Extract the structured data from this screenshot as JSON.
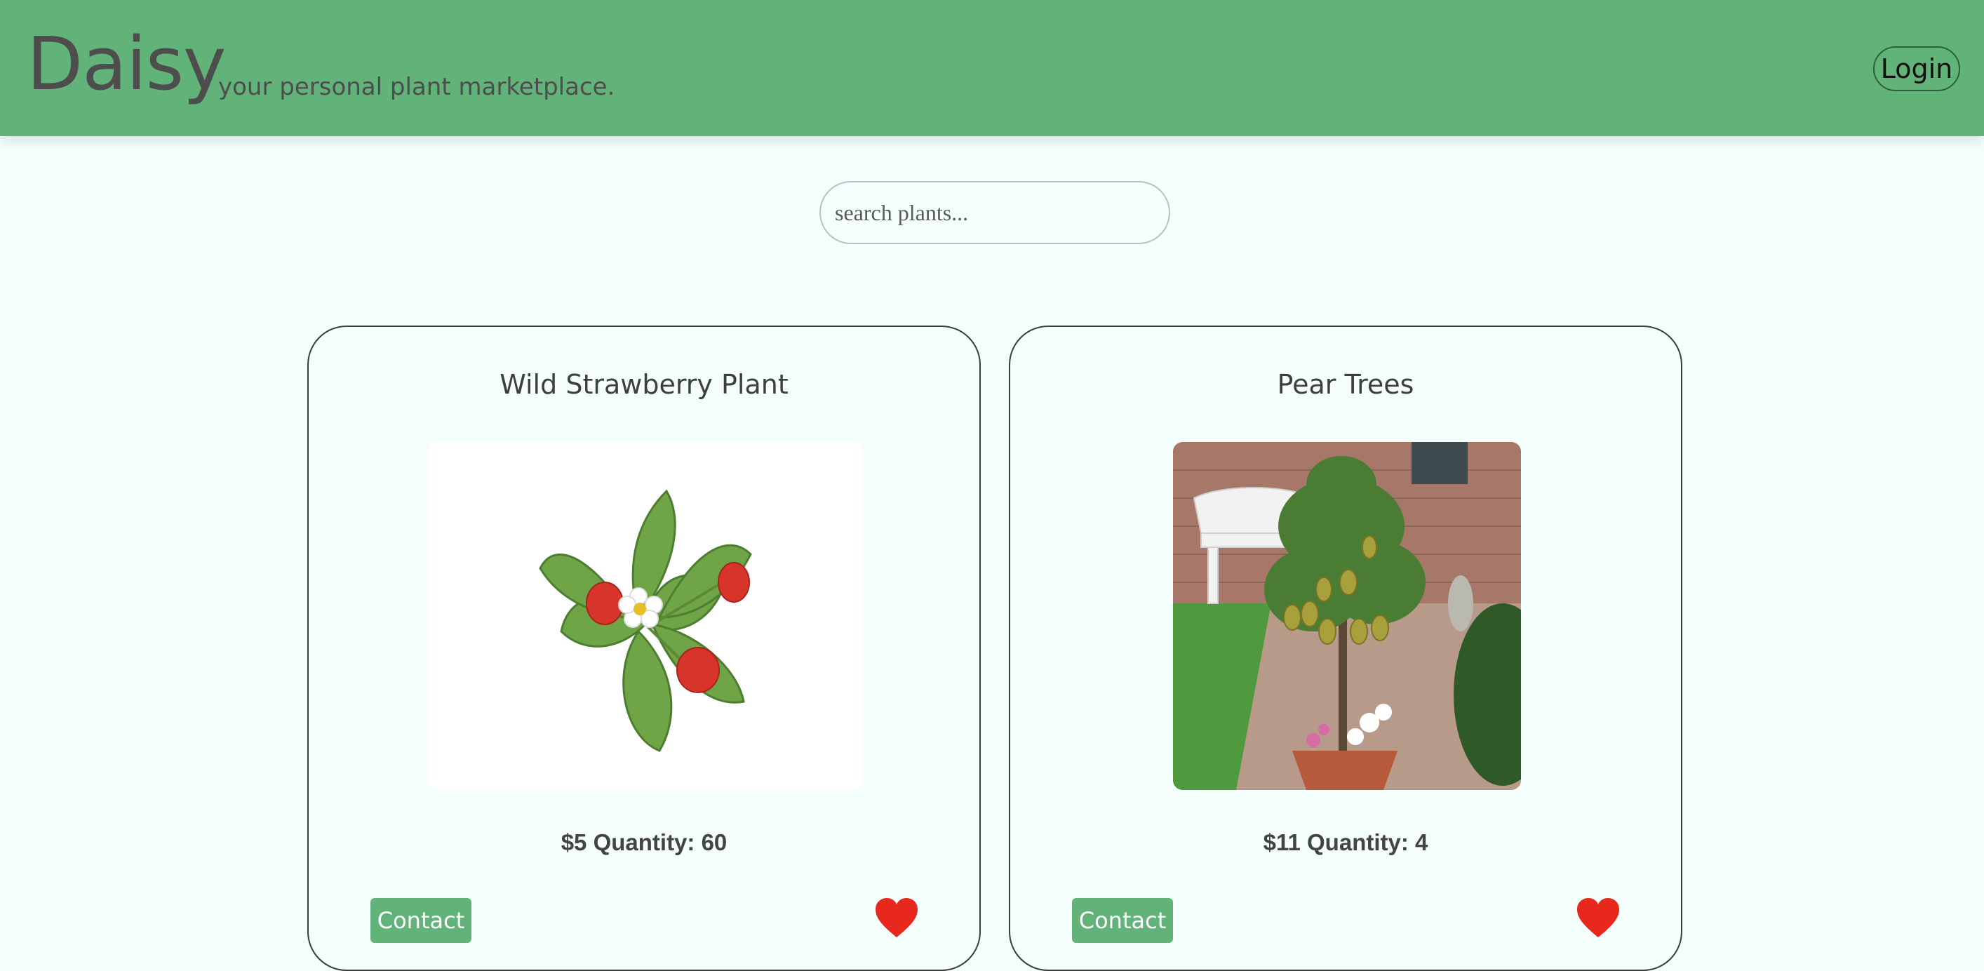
{
  "header": {
    "brand": "Daisy",
    "tagline": "your personal plant marketplace.",
    "login_label": "Login"
  },
  "search": {
    "placeholder": "search plants..."
  },
  "listings": [
    {
      "title": "Wild Strawberry Plant",
      "price_quantity": "$5 Quantity: 60",
      "contact_label": "Contact",
      "image": "strawberry-plant-image"
    },
    {
      "title": "Pear Trees",
      "price_quantity": "$11 Quantity: 4",
      "contact_label": "Contact",
      "image": "pear-tree-image"
    }
  ],
  "colors": {
    "header": "#62b37a",
    "background": "#f3fefd",
    "accent": "#62b37a",
    "heart": "#e8281d"
  },
  "icons": {
    "favorite": "heart-icon"
  }
}
